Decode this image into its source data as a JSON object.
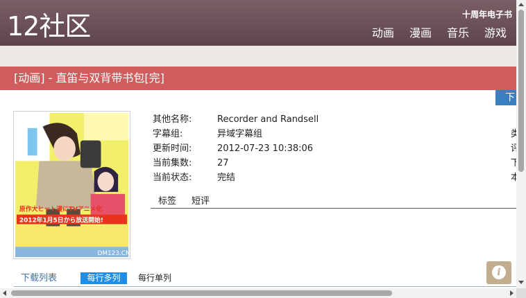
{
  "header": {
    "logo": "12社区",
    "tagline": "十周年电子书",
    "nav": [
      "动画",
      "漫画",
      "音乐",
      "游戏"
    ]
  },
  "title_bar": {
    "title": "[动画] - 直笛与双背带书包[完]"
  },
  "download_tab": {
    "label": "下"
  },
  "cover": {
    "alt_overlay_lines": [
      "原作大ヒット漫にTVアニメ化",
      "2012年1月5日から放送開始!"
    ],
    "watermark": "DM123.CN"
  },
  "info": {
    "rows": [
      {
        "label": "其他名称:",
        "value": "Recorder and Randsell"
      },
      {
        "label": "字幕组:",
        "value": "异域字幕组"
      },
      {
        "label": "更新时间:",
        "value": "2012-07-23 10:38:06"
      },
      {
        "label": "当前集数:",
        "value": "27"
      },
      {
        "label": "当前状态:",
        "value": "完结"
      }
    ],
    "edge_chars": [
      "类",
      "评",
      "下",
      "本"
    ]
  },
  "tabs": [
    "标签",
    "短评"
  ],
  "download_list": {
    "label": "下载列表",
    "mode_multi": "每行多列",
    "mode_single": "每行单列"
  },
  "colors": {
    "header": "#6c5158",
    "title_bar": "#d05d5d",
    "accent_blue": "#1e8ee8",
    "info_button": "#c2ae8f"
  },
  "icons": {
    "info_float": "info-icon"
  }
}
